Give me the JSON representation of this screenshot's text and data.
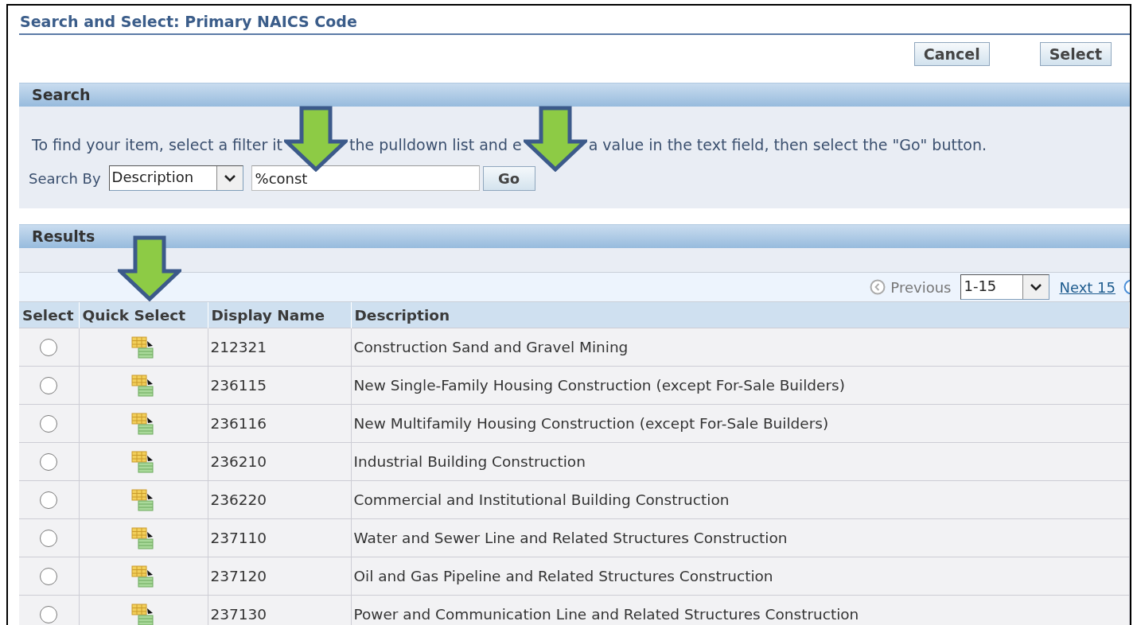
{
  "window": {
    "title": "Search and Select: Primary NAICS Code"
  },
  "buttons": [
    {
      "label": "Cancel"
    },
    {
      "label": "Select"
    }
  ],
  "search": {
    "heading": "Search",
    "instructions": [
      "To find your item, select a filter it",
      "the pulldown list and e",
      "a value in the text field, then select the \"Go\" button."
    ],
    "search_by_label": "Search By",
    "filter": "Description",
    "value": "%const",
    "go_button": "Go"
  },
  "results": {
    "heading": "Results",
    "pagination": {
      "previous": {
        "label": "Previous",
        "disabled": true
      },
      "range": "1-15",
      "next": {
        "label": "Next 15",
        "disabled": false
      }
    },
    "columns": [
      "Select",
      "Quick Select",
      "Display Name",
      "Description"
    ],
    "rows": [
      {
        "selected": false,
        "display_name": "212321",
        "description": "Construction Sand and Gravel Mining"
      },
      {
        "selected": false,
        "display_name": "236115",
        "description": "New Single-Family Housing Construction (except For-Sale Builders)"
      },
      {
        "selected": false,
        "display_name": "236116",
        "description": "New Multifamily Housing Construction (except For-Sale Builders)"
      },
      {
        "selected": false,
        "display_name": "236210",
        "description": "Industrial Building Construction"
      },
      {
        "selected": false,
        "display_name": "236220",
        "description": "Commercial and Institutional Building Construction"
      },
      {
        "selected": false,
        "display_name": "237110",
        "description": "Water and Sewer Line and Related Structures Construction"
      },
      {
        "selected": false,
        "display_name": "237120",
        "description": "Oil and Gas Pipeline and Related Structures Construction"
      },
      {
        "selected": false,
        "display_name": "237130",
        "description": "Power and Communication Line and Related Structures Construction"
      }
    ]
  },
  "callout_arrows": [
    {
      "kind": "down"
    },
    {
      "kind": "down"
    },
    {
      "kind": "down"
    }
  ]
}
